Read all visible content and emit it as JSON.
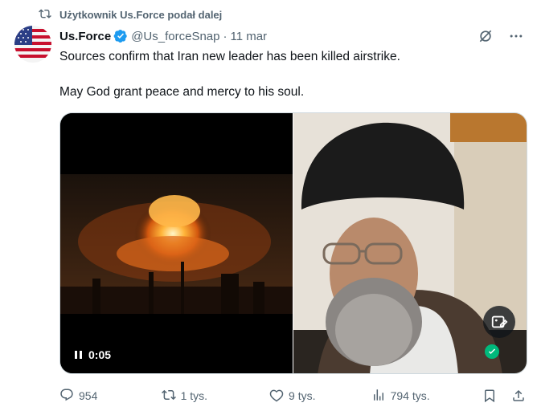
{
  "repost": {
    "label": "Użytkownik Us.Force podał dalej",
    "icon": "retweet-icon"
  },
  "tweet": {
    "author_name": "Us.Force",
    "handle": "@Us_forceSnap",
    "separator": "·",
    "date": "11 mar",
    "text_line1": "Sources confirm that Iran  new leader has been killed airstrike.",
    "text_line2": "May God grant peace and mercy to his soul."
  },
  "media": {
    "video_time": "0:05",
    "left_icon": "pause-icon",
    "edit_icon": "image-edit-icon",
    "badge_icon": "check-icon"
  },
  "actions": {
    "replies": "954",
    "retweets": "1 tys.",
    "likes": "9 tys.",
    "views": "794 tys."
  },
  "colors": {
    "verified": "#1d9bf0",
    "muted": "#536471",
    "text": "#0f1419",
    "green": "#00ba7c"
  }
}
